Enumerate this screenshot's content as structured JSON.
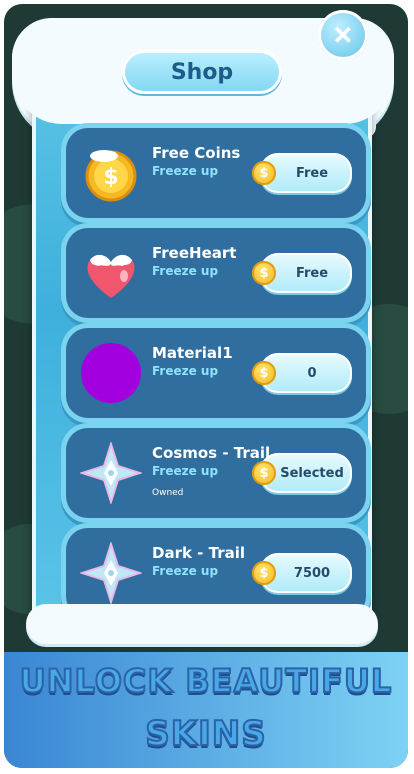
{
  "shop": {
    "title": "Shop",
    "close_icon": "close-icon",
    "items": [
      {
        "title": "Free Coins",
        "subtitle": "Freeze up",
        "owned": "",
        "price": "Free",
        "icon": "coins-icon"
      },
      {
        "title": "FreeHeart",
        "subtitle": "Freeze up",
        "owned": "",
        "price": "Free",
        "icon": "heart-icon"
      },
      {
        "title": "Material1",
        "subtitle": "Freeze up",
        "owned": "",
        "price": "0",
        "icon": "purple-circle-icon",
        "icon_color": "#a300e0"
      },
      {
        "title": "Cosmos - Trail",
        "subtitle": "Freeze up",
        "owned": "Owned",
        "price": "Selected",
        "icon": "crystal-star-icon"
      },
      {
        "title": "Dark - Trail",
        "subtitle": "Freeze up",
        "owned": "",
        "price": "7500",
        "icon": "crystal-star-icon"
      }
    ]
  },
  "promo": {
    "line1": "UNLOCK BEAUTIFUL",
    "line2": "SKINS"
  },
  "colors": {
    "accent": "#5cc4e8",
    "row_bg": "#2f6e9e",
    "coin": "#f4b51c"
  }
}
